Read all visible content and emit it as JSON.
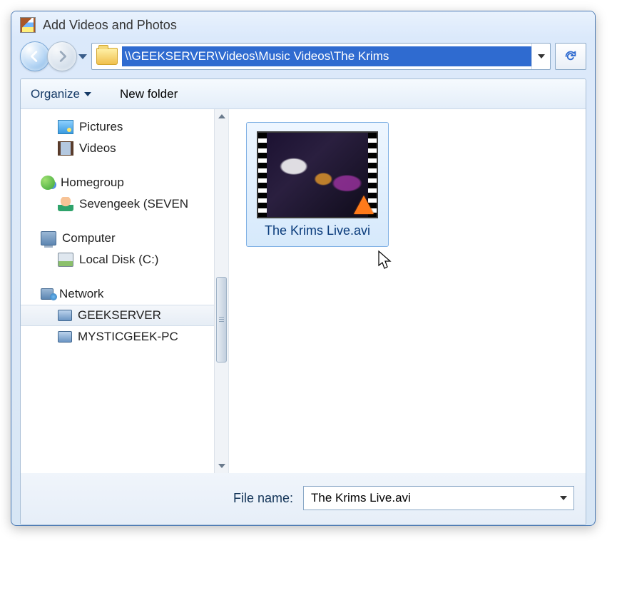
{
  "window": {
    "title": "Add Videos and Photos"
  },
  "nav": {
    "path": "\\\\GEEKSERVER\\Videos\\Music Videos\\The Krims"
  },
  "toolbar": {
    "organize": "Organize",
    "new_folder": "New folder"
  },
  "tree": {
    "items": [
      {
        "icon": "pic",
        "label": "Pictures",
        "sub": true
      },
      {
        "icon": "vid",
        "label": "Videos",
        "sub": true
      },
      {
        "gap": true
      },
      {
        "icon": "home",
        "label": "Homegroup"
      },
      {
        "icon": "user",
        "label": "Sevengeek (SEVEN",
        "sub": true
      },
      {
        "gap": true
      },
      {
        "icon": "comp",
        "label": "Computer"
      },
      {
        "icon": "disk",
        "label": "Local Disk (C:)",
        "sub": true
      },
      {
        "gap": true
      },
      {
        "icon": "net",
        "label": "Network"
      },
      {
        "icon": "netpc",
        "label": "GEEKSERVER",
        "sub": true,
        "selected": true
      },
      {
        "icon": "netpc",
        "label": "MYSTICGEEK-PC",
        "sub": true
      }
    ]
  },
  "files": {
    "items": [
      {
        "name": "The Krims Live.avi"
      }
    ]
  },
  "footer": {
    "label": "File name:",
    "value": "The Krims Live.avi"
  }
}
